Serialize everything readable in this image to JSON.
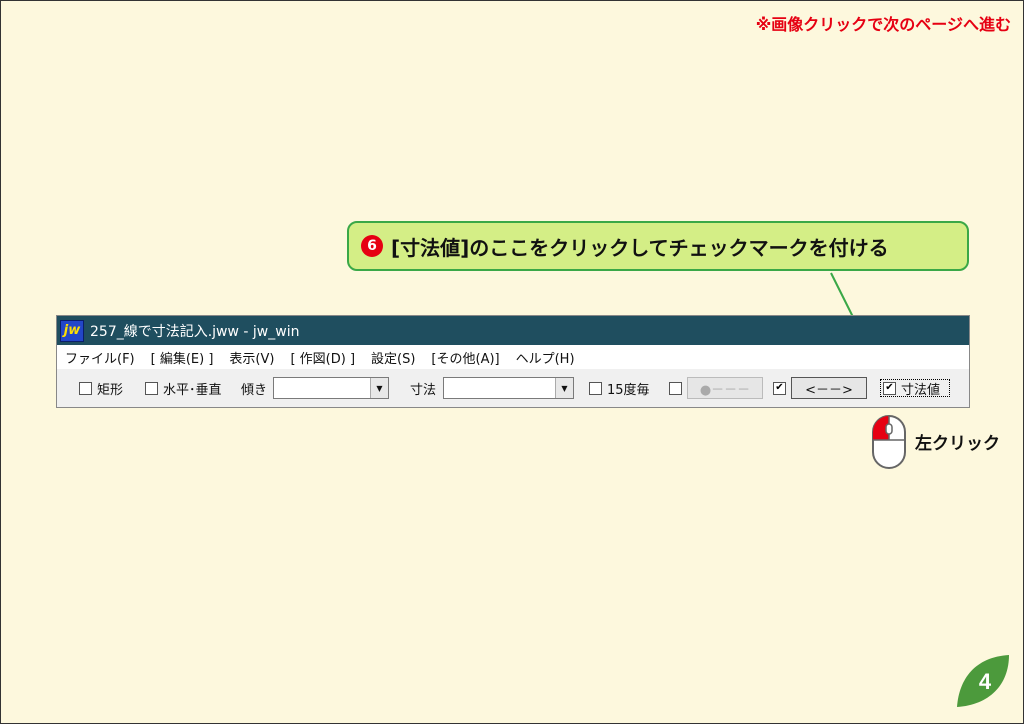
{
  "notice": "※画像クリックで次のページへ進む",
  "callout": {
    "step": "6",
    "text": "[寸法値]のここをクリックしてチェックマークを付ける"
  },
  "window": {
    "app_icon_text": "jw",
    "title": "257_線で寸法記入.jww - jw_win",
    "menu": [
      "ファイル(F)",
      "[ 編集(E) ]",
      "表示(V)",
      "[ 作図(D) ]",
      "設定(S)",
      "[その他(A)]",
      "ヘルプ(H)"
    ],
    "toolbar": {
      "rect_label": "矩形",
      "hv_label": "水平･垂直",
      "slope_label": "傾き",
      "slope_value": "",
      "dim_label": "寸法",
      "dim_value": "",
      "deg15_label": "15度毎",
      "dot_button": "●－－－",
      "arrow_button": "<－－>",
      "dimval_label": "寸法値",
      "check_mark": "✔"
    }
  },
  "mouse_label": "左クリック",
  "page_number": "4",
  "colors": {
    "accent_red": "#e60012",
    "callout_bg": "#d4ee86",
    "callout_border": "#3aa847",
    "titlebar": "#1f4e5f",
    "leaf": "#4c9a3c"
  }
}
